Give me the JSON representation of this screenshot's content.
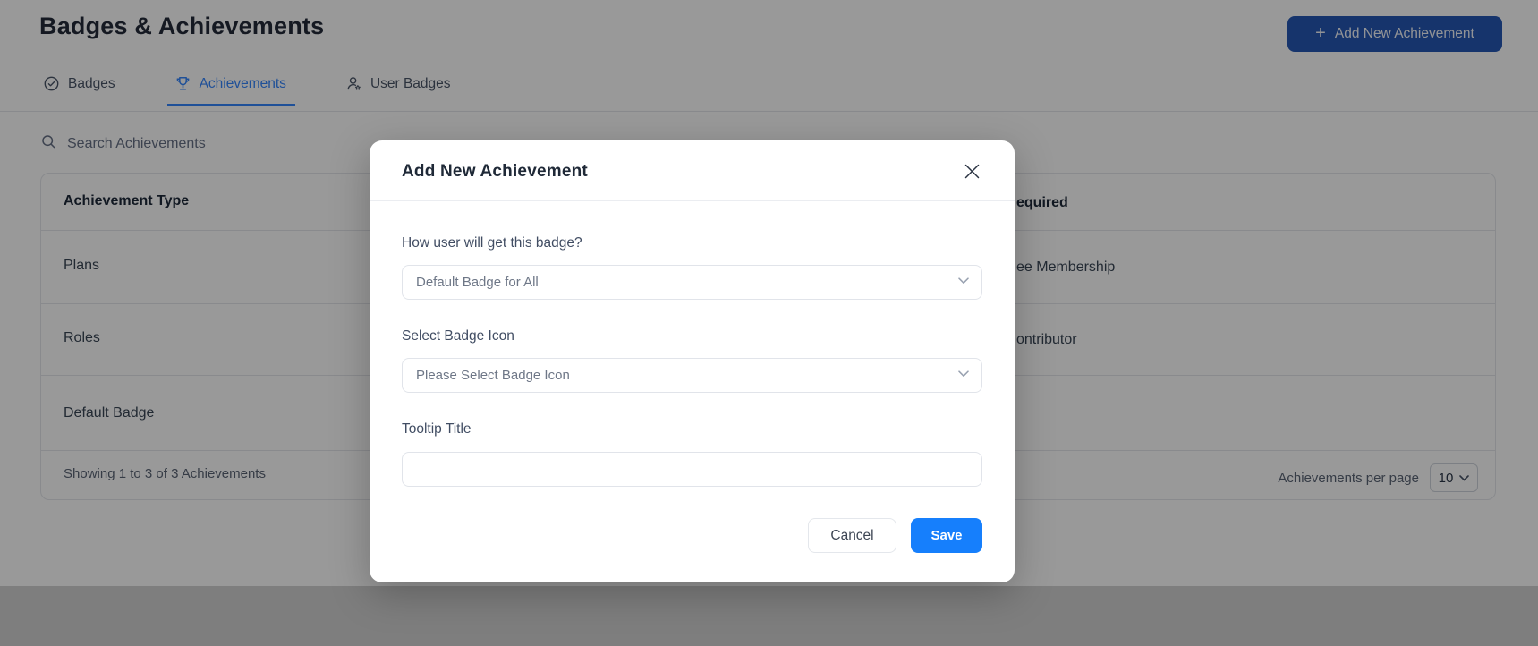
{
  "page": {
    "title": "Badges & Achievements",
    "add_button": {
      "plus": "+",
      "label": "Add New Achievement"
    },
    "tabs": [
      {
        "label": "Badges"
      },
      {
        "label": "Achievements"
      },
      {
        "label": "User Badges"
      }
    ],
    "search": {
      "placeholder": "Search Achievements"
    },
    "table": {
      "column_header": "Achievement Type",
      "column_header_fragment_right": "equired",
      "rows": [
        {
          "type": "Plans",
          "right_fragment": "ee Membership"
        },
        {
          "type": "Roles",
          "right_fragment": "ontributor"
        },
        {
          "type": "Default Badge",
          "right_fragment": ""
        }
      ],
      "footer": {
        "showing": "Showing 1 to 3 of 3 Achievements",
        "per_page_label": "Achievements per page",
        "per_page_value": "10"
      }
    }
  },
  "modal": {
    "title": "Add New Achievement",
    "fields": [
      {
        "label": "How user will get this badge?",
        "value": "Default Badge for All"
      },
      {
        "label": "Select Badge Icon",
        "value": "Please Select Badge Icon"
      },
      {
        "label": "Tooltip Title",
        "value": ""
      }
    ],
    "cancel_label": "Cancel",
    "save_label": "Save"
  },
  "colors": {
    "accent_blue": "#3485fd",
    "save_blue": "#167ffc",
    "add_button_navy": "#2558b4",
    "overlay": "rgba(0,0,0,0.4)",
    "border": "#e4e7ec"
  }
}
